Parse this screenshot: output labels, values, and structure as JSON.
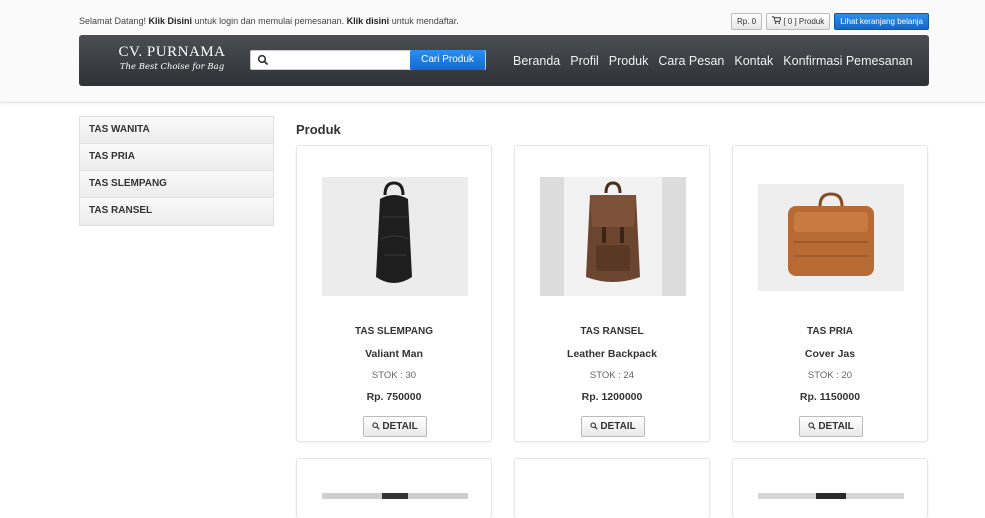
{
  "topbar": {
    "welcome_prefix": "Selamat Datang! ",
    "login_link": "Klik Disini",
    "welcome_middle": " untuk login dan memulai pemesanan. ",
    "register_link": "Klik disini",
    "welcome_suffix": " untuk mendaftar.",
    "cart_total": "Rp. 0",
    "cart_count": "[ 0 ] Produk",
    "view_cart": "Lihat keranjang belanja"
  },
  "brand": {
    "name": "CV. PURNAMA",
    "tagline": "The Best Choise for Bag"
  },
  "search": {
    "placeholder": "",
    "value": "",
    "button": "Cari Produk"
  },
  "menu": [
    "Beranda",
    "Profil",
    "Produk",
    "Cara Pesan",
    "Kontak",
    "Konfirmasi Pemesanan"
  ],
  "categories": [
    "TAS WANITA",
    "TAS PRIA",
    "TAS SLEMPANG",
    "TAS RANSEL"
  ],
  "section_title": "Produk",
  "products": [
    {
      "category": "TAS SLEMPANG",
      "name": "Valiant Man",
      "stock": "STOK : 30",
      "price": "Rp. 750000",
      "detail": "DETAIL"
    },
    {
      "category": "TAS RANSEL",
      "name": "Leather Backpack",
      "stock": "STOK : 24",
      "price": "Rp. 1200000",
      "detail": "DETAIL"
    },
    {
      "category": "TAS PRIA",
      "name": "Cover Jas",
      "stock": "STOK : 20",
      "price": "Rp. 1150000",
      "detail": "DETAIL"
    }
  ],
  "colors": {
    "navbar": "#3a3e42",
    "primary_button": "#1e7ad9",
    "page_bg": "#ffffff"
  }
}
